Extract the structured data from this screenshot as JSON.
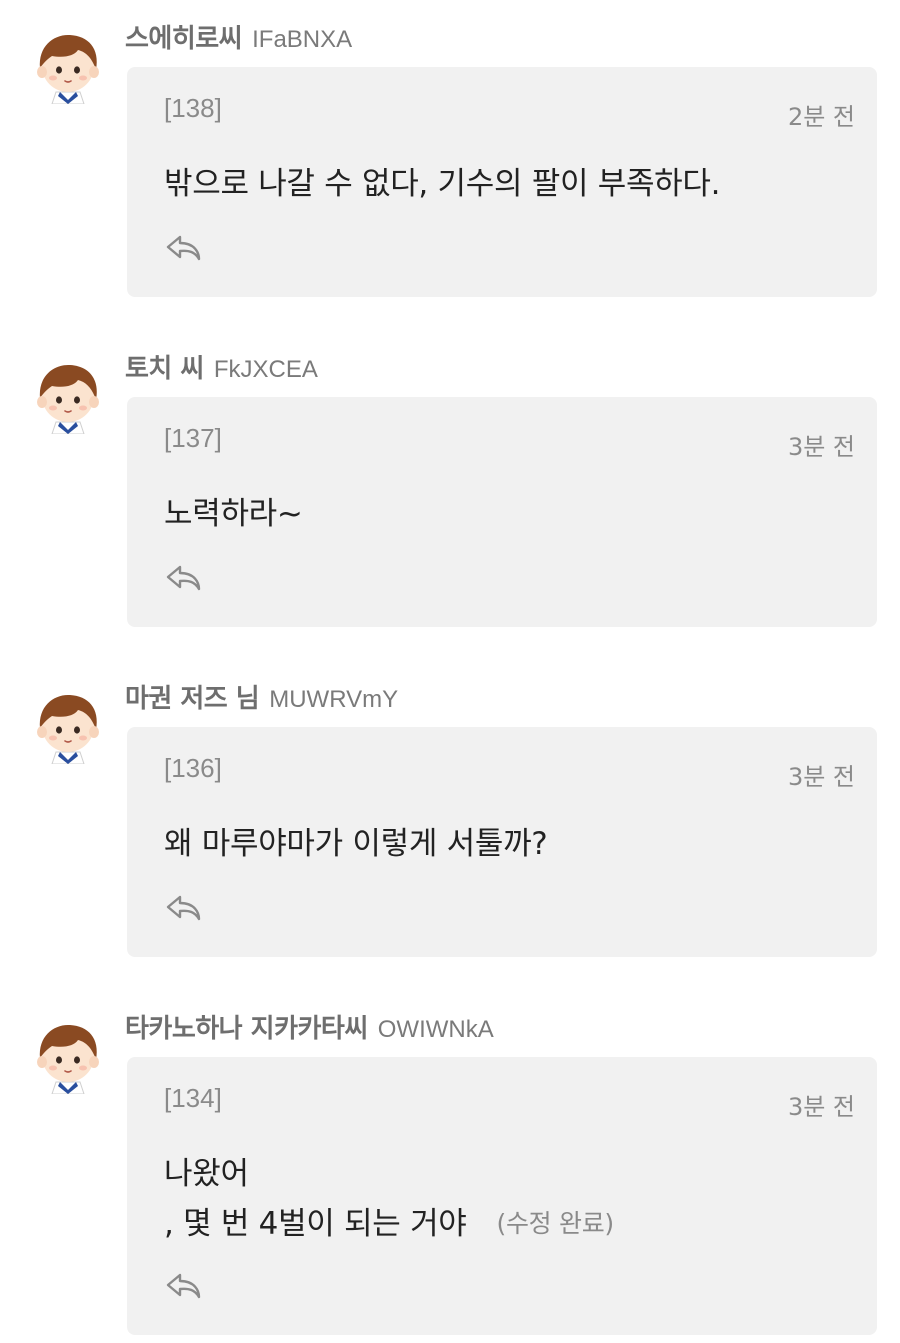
{
  "colors": {
    "bubble_bg": "#f1f1f1",
    "nickname": "#6e6e6e",
    "meta_text": "#8a8a8a",
    "body_text": "#222222"
  },
  "comments": [
    {
      "nickname": "스에히로씨",
      "user_id": "IFaBNXA",
      "post_no": "[138]",
      "time": "2분 전",
      "lines": [
        "밖으로 나갈 수 없다, 기수의 팔이 부족하다."
      ],
      "edited": "",
      "avatar_icon": "boy-avatar-icon",
      "reply_icon": "reply-arrow-icon"
    },
    {
      "nickname": "토치 씨",
      "user_id": "FkJXCEA",
      "post_no": "[137]",
      "time": "3분 전",
      "lines": [
        "노력하라~"
      ],
      "edited": "",
      "avatar_icon": "boy-avatar-icon",
      "reply_icon": "reply-arrow-icon"
    },
    {
      "nickname": "마권 저즈 님",
      "user_id": "MUWRVmY",
      "post_no": "[136]",
      "time": "3분 전",
      "lines": [
        "왜 마루야마가 이렇게 서툴까?"
      ],
      "edited": "",
      "avatar_icon": "boy-avatar-icon",
      "reply_icon": "reply-arrow-icon"
    },
    {
      "nickname": "타카노하나 지카카타씨",
      "user_id": "OWIWNkA",
      "post_no": "[134]",
      "time": "3분 전",
      "lines": [
        "나왔어",
        ", 몇 번 4벌이 되는 거야"
      ],
      "edited": "(수정 완료)",
      "avatar_icon": "boy-avatar-icon",
      "reply_icon": "reply-arrow-icon"
    }
  ]
}
